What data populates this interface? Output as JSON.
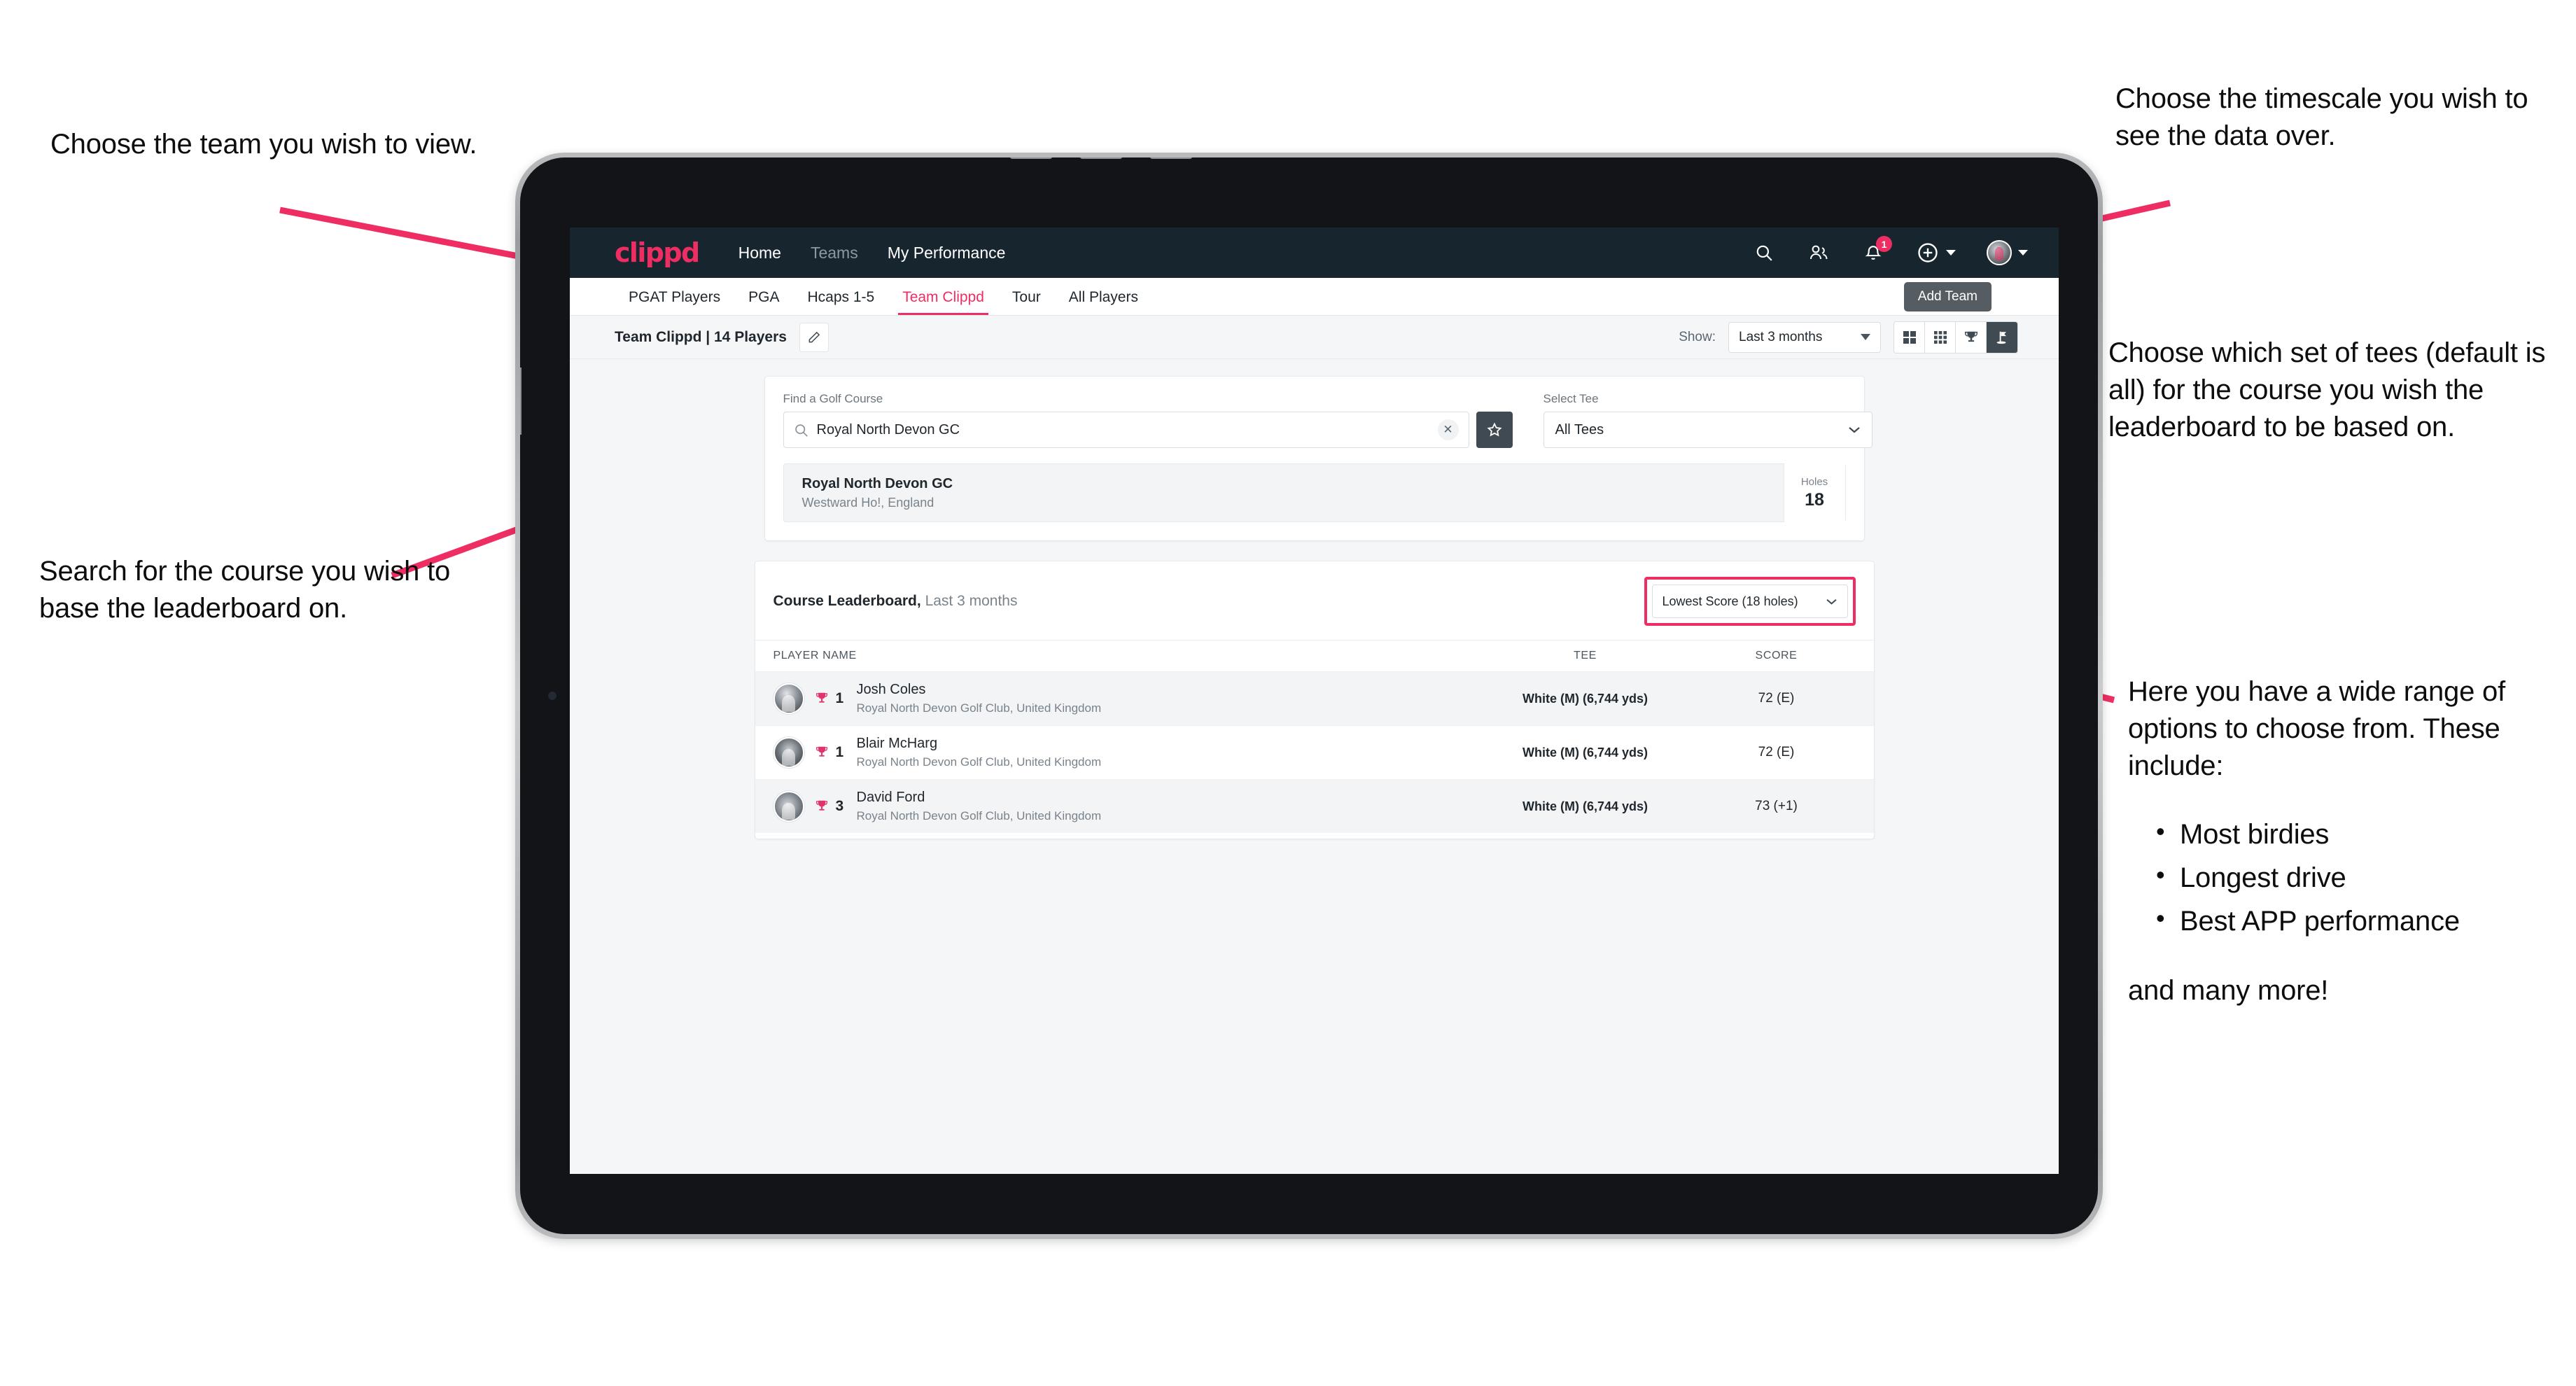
{
  "annotations": {
    "team": "Choose the team you wish to view.",
    "search": "Search for the course you wish to base the leaderboard on.",
    "timescale": "Choose the timescale you wish to see the data over.",
    "tees": "Choose which set of tees (default is all) for the course you wish the leaderboard to be based on.",
    "options_lead": "Here you have a wide range of options to choose from. These include:",
    "options_bullets": [
      "Most birdies",
      "Longest drive",
      "Best APP performance"
    ],
    "options_tail": "and many more!"
  },
  "navbar": {
    "logo": "clippd",
    "links": [
      {
        "label": "Home",
        "dim": false
      },
      {
        "label": "Teams",
        "dim": true
      },
      {
        "label": "My Performance",
        "dim": false
      }
    ],
    "notification_count": "1",
    "tooltip": "Add Team"
  },
  "tabs": [
    {
      "label": "PGAT Players",
      "state": "normal"
    },
    {
      "label": "PGA",
      "state": "normal"
    },
    {
      "label": "Hcaps 1-5",
      "state": "normal"
    },
    {
      "label": "Team Clippd",
      "state": "active"
    },
    {
      "label": "Tour",
      "state": "normal"
    },
    {
      "label": "All Players",
      "state": "normal"
    }
  ],
  "toolbar": {
    "team_name": "Team Clippd",
    "team_separator": " | ",
    "player_count": "14 Players",
    "show_label": "Show:",
    "timescale_value": "Last 3 months",
    "view_buttons": [
      "grid-4-icon",
      "grid-9-icon",
      "trophy-icon",
      "golf-flag-icon"
    ],
    "active_view": "golf-flag-icon"
  },
  "search": {
    "course_label": "Find a Golf Course",
    "course_value": "Royal North Devon GC",
    "course_placeholder": "Find a Golf Course",
    "tee_label": "Select Tee",
    "tee_value": "All Tees"
  },
  "course_result": {
    "name": "Royal North Devon GC",
    "location": "Westward Ho!, England",
    "holes_label": "Holes",
    "holes_value": "18"
  },
  "leaderboard": {
    "title": "Course Leaderboard,",
    "subtitle": " Last 3 months",
    "metric": "Lowest Score (18 holes)",
    "columns": {
      "player": "PLAYER NAME",
      "tee": "TEE",
      "score": "SCORE"
    },
    "rows": [
      {
        "rank": "1",
        "name": "Josh Coles",
        "club": "Royal North Devon Golf Club, United Kingdom",
        "tee": "White (M) (6,744 yds)",
        "score": "72 (E)"
      },
      {
        "rank": "1",
        "name": "Blair McHarg",
        "club": "Royal North Devon Golf Club, United Kingdom",
        "tee": "White (M) (6,744 yds)",
        "score": "72 (E)"
      },
      {
        "rank": "3",
        "name": "David Ford",
        "club": "Royal North Devon Golf Club, United Kingdom",
        "tee": "White (M) (6,744 yds)",
        "score": "73 (+1)"
      }
    ]
  },
  "colors": {
    "accent": "#ee2e63",
    "navbar": "#17252f",
    "page_bg": "#f4f6f8",
    "dark_button": "#3f4a52"
  }
}
